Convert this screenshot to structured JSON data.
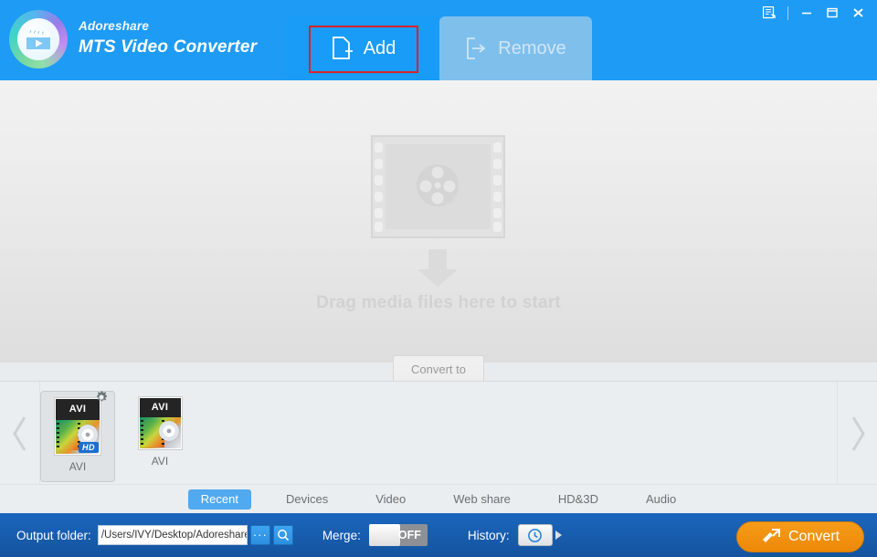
{
  "window": {
    "brand_company": "Adoreshare",
    "brand_product": "MTS Video Converter",
    "controls": {
      "feedback": "feedback-icon",
      "minimize": "—",
      "maximize": "▭",
      "close": "✕"
    },
    "accent_blue": "#1e9bf5",
    "highlight_red": "#d8232a"
  },
  "toolbar": {
    "add_label": "Add",
    "remove_label": "Remove",
    "add_highlighted": true,
    "remove_enabled": false
  },
  "drop_area": {
    "message": "Drag media files here to start",
    "film_icon": "film-strip-icon",
    "arrow_icon": "arrow-down-icon"
  },
  "convert_tab": {
    "label": "Convert to"
  },
  "formats": {
    "prev_label": "‹",
    "next_label": "›",
    "items": [
      {
        "ext": "AVI",
        "label": "AVI",
        "badge": "HD",
        "selected": true,
        "has_gear": true
      },
      {
        "ext": "AVI",
        "label": "AVI",
        "badge": "",
        "selected": false,
        "has_gear": false
      }
    ]
  },
  "categories": {
    "tabs": [
      {
        "label": "Recent",
        "active": true
      },
      {
        "label": "Devices",
        "active": false
      },
      {
        "label": "Video",
        "active": false
      },
      {
        "label": "Web share",
        "active": false
      },
      {
        "label": "HD&3D",
        "active": false
      },
      {
        "label": "Audio",
        "active": false
      }
    ]
  },
  "bottom": {
    "output_folder_label": "Output folder:",
    "output_folder_value": "/Users/IVY/Desktop/Adoreshare",
    "browse_label": "···",
    "search_icon": "magnifier-icon",
    "merge_label": "Merge:",
    "merge_state": "OFF",
    "history_label": "History:",
    "history_icon": "clock-icon",
    "convert_label": "Convert",
    "convert_color": "#ee8807"
  }
}
